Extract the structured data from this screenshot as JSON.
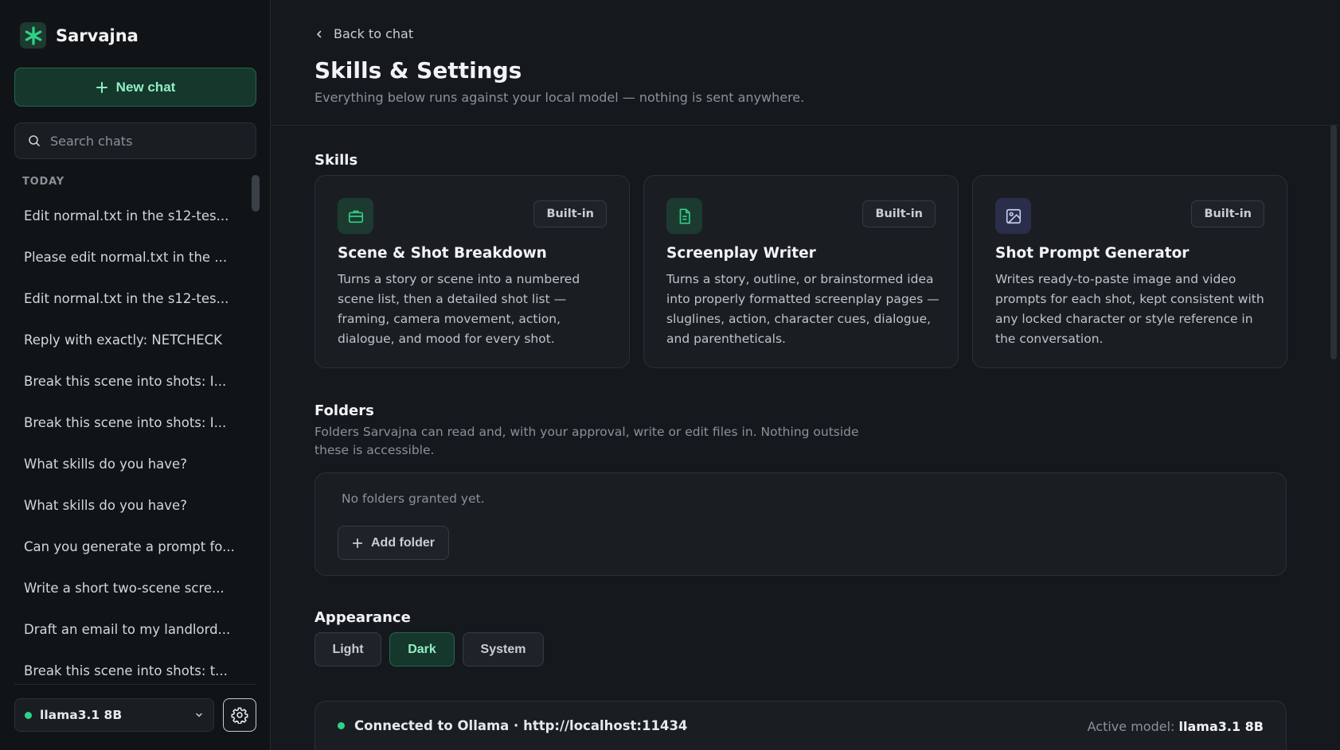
{
  "sidebar": {
    "brand_name": "Sarvajna",
    "new_chat_label": "New chat",
    "search_placeholder": "Search chats",
    "section_label": "TODAY",
    "chats": [
      "Edit normal.txt in the s12-tes...",
      "Please edit normal.txt in the ...",
      "Edit normal.txt in the s12-tes...",
      "Reply with exactly: NETCHECK",
      "Break this scene into shots: I...",
      "Break this scene into shots: I...",
      "What skills do you have?",
      "What skills do you have?",
      "Can you generate a prompt fo...",
      "Write a short two-scene scre...",
      "Draft an email to my landlord...",
      "Break this scene into shots: t..."
    ],
    "model_label": "llama3.1 8B"
  },
  "main": {
    "back_label": "Back to chat",
    "title": "Skills & Settings",
    "subtitle": "Everything below runs against your local model — nothing is sent anywhere.",
    "skills_heading": "Skills",
    "skills": [
      {
        "name": "Scene & Shot Breakdown",
        "badge": "Built-in",
        "icon": "briefcase-icon",
        "description": "Turns a story or scene into a numbered scene list, then a detailed shot list — framing, camera movement, action, dialogue, and mood for every shot."
      },
      {
        "name": "Screenplay Writer",
        "badge": "Built-in",
        "icon": "document-icon",
        "description": "Turns a story, outline, or brainstormed idea into properly formatted screenplay pages — sluglines, action, character cues, dialogue, and parentheticals."
      },
      {
        "name": "Shot Prompt Generator",
        "badge": "Built-in",
        "icon": "image-icon",
        "description": "Writes ready-to-paste image and video prompts for each shot, kept consistent with any locked character or style reference in the conversation."
      }
    ],
    "folders_heading": "Folders",
    "folders_subtitle": "Folders Sarvajna can read and, with your approval, write or edit files in. Nothing outside these is accessible.",
    "folders_empty": "No folders granted yet.",
    "add_folder_label": "Add folder",
    "appearance_heading": "Appearance",
    "appearance_options": [
      "Light",
      "Dark",
      "System"
    ],
    "appearance_selected": "Dark",
    "status": {
      "connection": "Connected to Ollama · http://localhost:11434",
      "active_model_label": "Active model:",
      "active_model_value": "llama3.1 8B"
    }
  },
  "colors": {
    "accent": "#2fd285",
    "accent_text": "#8ff0c2",
    "background": "#15191d",
    "sidebar_bg": "#111417",
    "card_bg": "#1a1e23"
  }
}
